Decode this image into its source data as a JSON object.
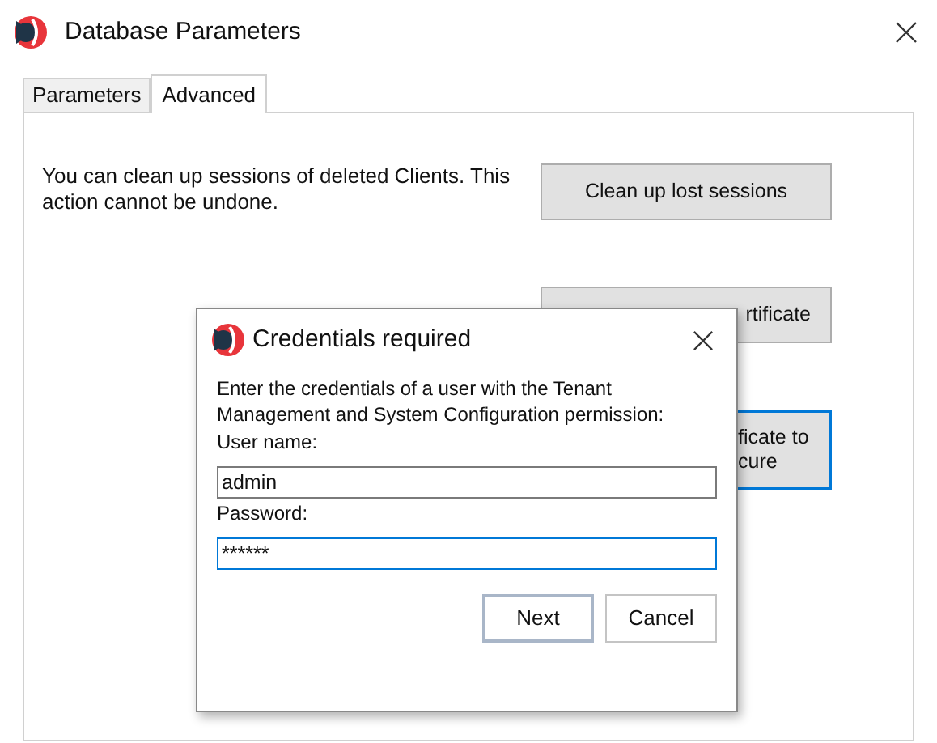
{
  "window": {
    "title": "Database Parameters"
  },
  "tabs": [
    {
      "label": "Parameters",
      "selected": false
    },
    {
      "label": "Advanced",
      "selected": true
    }
  ],
  "advanced": {
    "description": "You can clean up sessions of deleted Clients. This action cannot be undone.",
    "buttons": [
      {
        "lines": [
          "Clean up lost sessions"
        ],
        "focused": false
      },
      {
        "lines": [
          "rtificate"
        ],
        "focused": false
      },
      {
        "lines": [
          "ficate to",
          "cure"
        ],
        "focused": true
      }
    ]
  },
  "dialog": {
    "title": "Credentials required",
    "message": "Enter the credentials of a user with the Tenant Management and System Configuration permission:",
    "fields": [
      {
        "label": "User name:",
        "value": "admin",
        "focused": false
      },
      {
        "label": "Password:",
        "value": "******",
        "focused": true
      }
    ],
    "buttons": [
      "Next",
      "Cancel"
    ]
  }
}
